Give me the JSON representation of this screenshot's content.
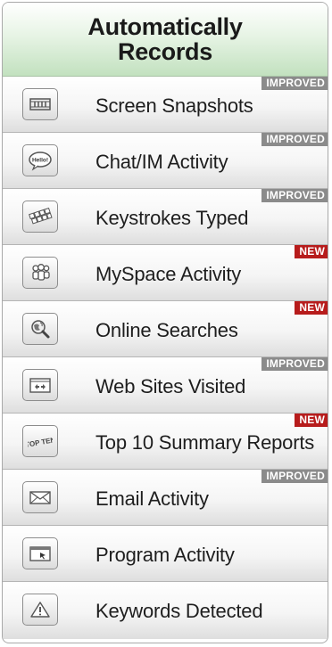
{
  "header": {
    "title_line1": "Automatically",
    "title_line2": "Records"
  },
  "colors": {
    "header_green": "#c2e1bf",
    "badge_improved": "#8b8b8b",
    "badge_new": "#b71c1c"
  },
  "items": [
    {
      "label": "Screen Snapshots",
      "badge": "IMPROVED",
      "icon": "film-strip-icon"
    },
    {
      "label": "Chat/IM Activity",
      "badge": "IMPROVED",
      "icon": "chat-bubble-icon"
    },
    {
      "label": "Keystrokes Typed",
      "badge": "IMPROVED",
      "icon": "keyboard-icon"
    },
    {
      "label": "MySpace Activity",
      "badge": "NEW",
      "icon": "myspace-people-icon"
    },
    {
      "label": "Online Searches",
      "badge": "NEW",
      "icon": "globe-magnifier-icon"
    },
    {
      "label": "Web Sites Visited",
      "badge": "IMPROVED",
      "icon": "browser-folder-icon"
    },
    {
      "label": "Top 10 Summary Reports",
      "badge": "NEW",
      "icon": "top-ten-icon",
      "icon_text": "TOP TEN"
    },
    {
      "label": "Email Activity",
      "badge": "IMPROVED",
      "icon": "envelope-icon"
    },
    {
      "label": "Program Activity",
      "badge": "",
      "icon": "program-window-icon"
    },
    {
      "label": "Keywords Detected",
      "badge": "",
      "icon": "warning-triangle-icon"
    }
  ]
}
